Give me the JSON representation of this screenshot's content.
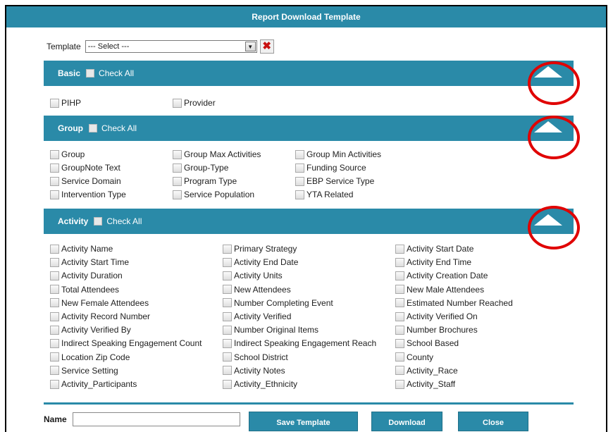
{
  "dialog": {
    "title": "Report Download Template"
  },
  "template": {
    "label": "Template",
    "selected": "--- Select ---",
    "clear_icon": "✖"
  },
  "sections": {
    "basic": {
      "title": "Basic",
      "check_all": "Check All",
      "fields": [
        "PIHP",
        "Provider"
      ]
    },
    "group": {
      "title": "Group",
      "check_all": "Check All",
      "fields": [
        "Group",
        "Group Max Activities",
        "Group Min Activities",
        "GroupNote Text",
        "Group-Type",
        "Funding Source",
        "Service Domain",
        "Program Type",
        "EBP Service Type",
        "Intervention Type",
        "Service Population",
        "YTA Related"
      ]
    },
    "activity": {
      "title": "Activity",
      "check_all": "Check All",
      "fields": [
        "Activity Name",
        "Primary Strategy",
        "Activity Start Date",
        "Activity Start Time",
        "Activity End Date",
        "Activity End Time",
        "Activity Duration",
        "Activity Units",
        "Activity Creation Date",
        "Total Attendees",
        "New Attendees",
        "New Male Attendees",
        "New Female Attendees",
        "Number Completing Event",
        "Estimated Number Reached",
        "Activity Record Number",
        "Activity Verified",
        "Activity Verified On",
        "Activity Verified By",
        "Number Original Items",
        "Number Brochures",
        "Indirect Speaking Engagement Count",
        "Indirect Speaking Engagement Reach",
        "School Based",
        "Location Zip Code",
        "School District",
        "County",
        "Service Setting",
        "Activity Notes",
        "Activity_Race",
        "Activity_Participants",
        "Activity_Ethnicity",
        "Activity_Staff"
      ]
    }
  },
  "footer": {
    "name_label": "Name",
    "name_value": "",
    "save_label": "Save Template",
    "download_label": "Download",
    "close_label": "Close"
  },
  "colors": {
    "header": "#2a8aa8",
    "highlight_circle": "#e00000"
  }
}
